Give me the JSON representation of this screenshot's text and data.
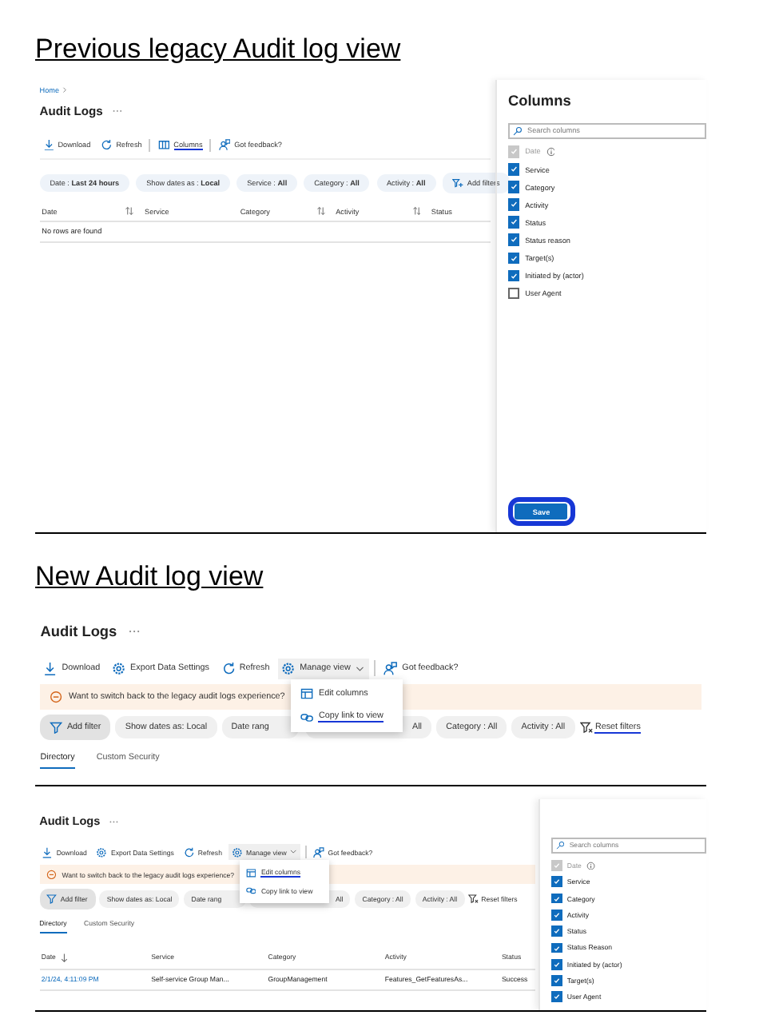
{
  "legacy": {
    "heading": "Previous legacy Audit log view",
    "breadcrumb": "Home",
    "title": "Audit Logs",
    "toolbar": [
      {
        "kind": "download",
        "label": "Download"
      },
      {
        "kind": "refresh",
        "label": "Refresh"
      },
      {
        "kind": "columns",
        "label": "Columns",
        "annotated": true,
        "divider_before": true
      },
      {
        "kind": "feedback",
        "label": "Got feedback?",
        "divider_before": true
      }
    ],
    "filters": [
      {
        "kind": "pill",
        "label": "Date : **Last 24 hours**"
      },
      {
        "kind": "pill",
        "label": "Show dates as : **Local**"
      },
      {
        "kind": "pill",
        "label": "Service : **All**"
      },
      {
        "kind": "pill",
        "label": "Category : **All**"
      },
      {
        "kind": "pill",
        "label": "Activity : **All**"
      },
      {
        "kind": "add",
        "label": "Add filters"
      }
    ],
    "table": {
      "columns": [
        {
          "label": "Date",
          "sortable": true
        },
        {
          "label": "Service",
          "sortable": false
        },
        {
          "label": "Category",
          "sortable": true
        },
        {
          "label": "Activity",
          "sortable": true
        },
        {
          "label": "Status",
          "sortable": false
        }
      ],
      "empty": "No rows are found"
    },
    "column_panel": {
      "title": "Columns",
      "search_placeholder": "Search columns",
      "items": [
        {
          "label": "Date",
          "checked": true,
          "disabled": true,
          "info": true
        },
        {
          "label": "Service",
          "checked": true,
          "disabled": false
        },
        {
          "label": "Category",
          "checked": true,
          "disabled": false
        },
        {
          "label": "Activity",
          "checked": true,
          "disabled": false
        },
        {
          "label": "Status",
          "checked": true,
          "disabled": false
        },
        {
          "label": "Status reason",
          "checked": true,
          "disabled": false
        },
        {
          "label": "Target(s)",
          "checked": true,
          "disabled": false
        },
        {
          "label": "Initiated by (actor)",
          "checked": true,
          "disabled": false
        },
        {
          "label": "User Agent",
          "checked": false,
          "disabled": false
        }
      ],
      "save": {
        "label": "Save",
        "annotated": true
      }
    }
  },
  "new": {
    "heading": "New Audit log view",
    "screens": [
      {
        "title": "Audit Logs",
        "toolbar": [
          {
            "kind": "download",
            "label": "Download"
          },
          {
            "kind": "export",
            "label": "Export Data Settings"
          },
          {
            "kind": "refresh",
            "label": "Refresh"
          },
          {
            "kind": "manage",
            "label": "Manage view",
            "active": true,
            "menu": [
              {
                "kind": "edit_columns",
                "label": "Edit columns",
                "annotated": false
              },
              {
                "kind": "copy_link",
                "label": "Copy link to view",
                "annotated": true
              }
            ]
          },
          {
            "kind": "feedback",
            "label": "Got feedback?",
            "divider_before": true
          }
        ],
        "banner": "Want to switch back to the legacy audit logs experience?",
        "filters": [
          {
            "kind": "add",
            "label": "Add filter"
          },
          {
            "kind": "pill",
            "label": "Show dates as: Local"
          },
          {
            "kind": "pill_cut_end",
            "label": "Date rang"
          },
          {
            "kind": "pill_cut_start",
            "label": "All"
          },
          {
            "kind": "pill",
            "label": "Category : All"
          },
          {
            "kind": "pill",
            "label": "Activity : All"
          },
          {
            "kind": "reset",
            "label": "Reset filters",
            "annotated": true
          }
        ],
        "tabs": [
          {
            "label": "Directory",
            "selected": true
          },
          {
            "label": "Custom Security",
            "selected": false
          }
        ]
      },
      {
        "title": "Audit Logs",
        "toolbar": [
          {
            "kind": "download",
            "label": "Download"
          },
          {
            "kind": "export",
            "label": "Export Data Settings"
          },
          {
            "kind": "refresh",
            "label": "Refresh"
          },
          {
            "kind": "manage",
            "label": "Manage view",
            "active": true,
            "menu": [
              {
                "kind": "edit_columns",
                "label": "Edit columns",
                "annotated": true
              },
              {
                "kind": "copy_link",
                "label": "Copy link to view",
                "annotated": false
              }
            ]
          },
          {
            "kind": "feedback",
            "label": "Got feedback?",
            "divider_before": true
          }
        ],
        "banner": "Want to switch back to the legacy audit logs experience?",
        "filters": [
          {
            "kind": "add",
            "label": "Add filter"
          },
          {
            "kind": "pill",
            "label": "Show dates as: Local"
          },
          {
            "kind": "pill_cut_end",
            "label": "Date rang"
          },
          {
            "kind": "pill_cut_start",
            "label": "All"
          },
          {
            "kind": "pill",
            "label": "Category : All"
          },
          {
            "kind": "pill",
            "label": "Activity : All"
          },
          {
            "kind": "reset",
            "label": "Reset filters",
            "annotated": false
          }
        ],
        "tabs": [
          {
            "label": "Directory",
            "selected": true
          },
          {
            "label": "Custom Security",
            "selected": false
          }
        ],
        "table": {
          "columns": [
            {
              "label": "Date",
              "sorted": true
            },
            {
              "label": "Service",
              "sorted": false
            },
            {
              "label": "Category",
              "sorted": false
            },
            {
              "label": "Activity",
              "sorted": false
            },
            {
              "label": "Status",
              "sorted": false
            }
          ],
          "rows": [
            {
              "cells": [
                "2/1/24, 4:11:09 PM",
                "Self-service Group Man...",
                "GroupManagement",
                "Features_GetFeaturesAs...",
                "Success"
              ]
            }
          ]
        },
        "column_panel": {
          "search_placeholder": "Search columns",
          "items": [
            {
              "label": "Date",
              "checked": true,
              "disabled": true,
              "info": true
            },
            {
              "label": "Service",
              "checked": true,
              "disabled": false
            },
            {
              "label": "Category",
              "checked": true,
              "disabled": false
            },
            {
              "label": "Activity",
              "checked": true,
              "disabled": false
            },
            {
              "label": "Status",
              "checked": true,
              "disabled": false
            },
            {
              "label": "Status Reason",
              "checked": true,
              "disabled": false
            },
            {
              "label": "Initiated by (actor)",
              "checked": true,
              "disabled": false
            },
            {
              "label": "Target(s)",
              "checked": true,
              "disabled": false
            },
            {
              "label": "User Agent",
              "checked": true,
              "disabled": false
            }
          ]
        }
      }
    ]
  }
}
